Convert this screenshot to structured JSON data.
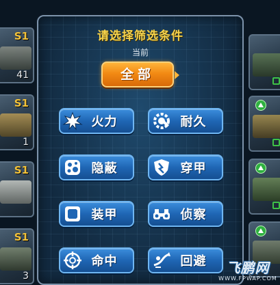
{
  "background": {
    "left_cards": [
      {
        "rank": "S1",
        "level": "41"
      },
      {
        "rank": "S1",
        "level": "1"
      },
      {
        "rank": "S1",
        "level": ""
      },
      {
        "rank": "S1",
        "level": "3"
      }
    ],
    "right_cards": [
      {
        "rank": ""
      },
      {
        "rank": ""
      },
      {
        "rank": ""
      },
      {
        "rank": ""
      }
    ]
  },
  "dialog": {
    "title": "请选择筛选条件",
    "current_label": "当前",
    "current_value": "全部",
    "filters": [
      {
        "label": "火力",
        "icon": "explosion-icon"
      },
      {
        "label": "耐久",
        "icon": "gear-wrench-icon"
      },
      {
        "label": "隐蔽",
        "icon": "camouflage-icon"
      },
      {
        "label": "穿甲",
        "icon": "pierced-shield-icon"
      },
      {
        "label": "装甲",
        "icon": "armor-plate-icon"
      },
      {
        "label": "侦察",
        "icon": "binoculars-icon"
      },
      {
        "label": "命中",
        "icon": "crosshair-icon"
      },
      {
        "label": "回避",
        "icon": "dodge-icon"
      }
    ]
  },
  "watermark": {
    "logo": "飞鹏网",
    "url": "WWW.FPWAP.COM"
  },
  "colors": {
    "title": "#f6d34c",
    "all_button": "#f28a14",
    "filter_button": "#1f66b4",
    "panel": "#14304a"
  }
}
